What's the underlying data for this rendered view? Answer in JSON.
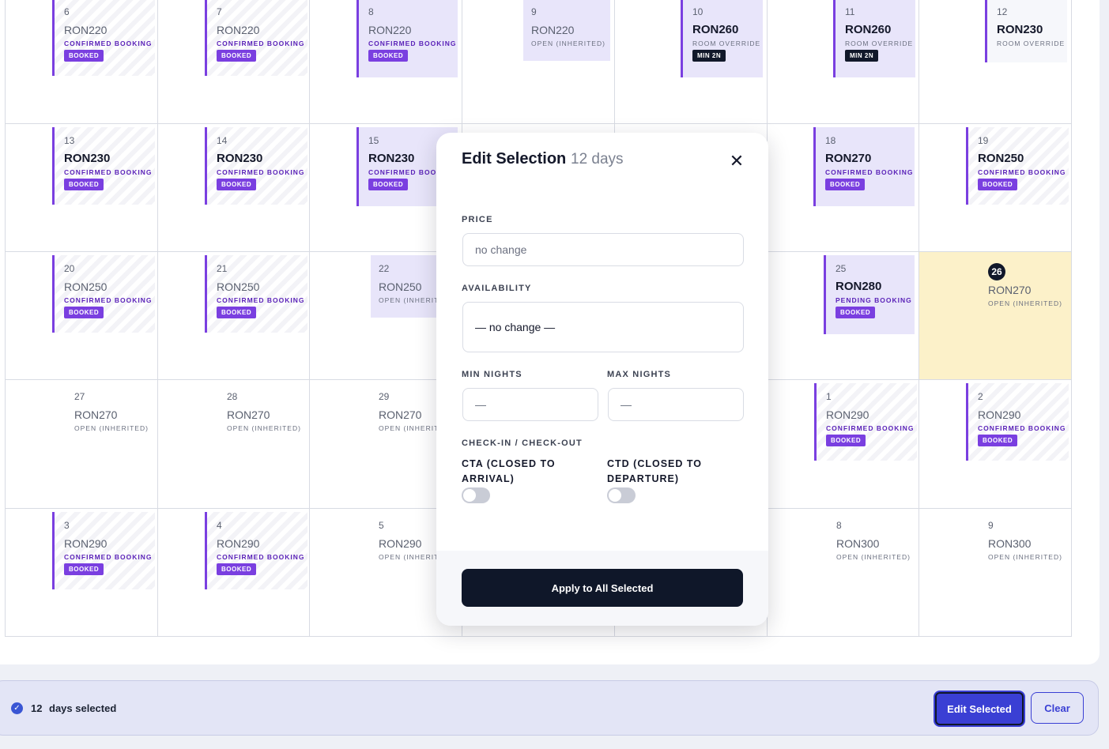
{
  "calendar": {
    "weeks": [
      [
        {
          "day": "6",
          "price": "RON220",
          "status": "CONFIRMED BOOKING",
          "badge": "BOOKED",
          "kind": "booked"
        },
        {
          "day": "7",
          "price": "RON220",
          "status": "CONFIRMED BOOKING",
          "badge": "BOOKED",
          "kind": "booked"
        },
        {
          "day": "8",
          "price": "RON220",
          "status": "CONFIRMED BOOKING",
          "badge": "BOOKED",
          "kind": "booked-hl"
        },
        {
          "day": "9",
          "price": "RON220",
          "status": "OPEN (INHERITED)",
          "kind": "open"
        },
        {
          "day": "10",
          "price": "RON260",
          "status": "ROOM OVERRIDE",
          "badge": "MIN 2N",
          "kind": "override"
        },
        {
          "day": "11",
          "price": "RON260",
          "status": "ROOM OVERRIDE",
          "badge": "MIN 2N",
          "kind": "override"
        },
        {
          "day": "12",
          "price": "RON230",
          "status": "ROOM OVERRIDE",
          "kind": "override-light"
        }
      ],
      [
        {
          "day": "13",
          "price": "RON230",
          "status": "CONFIRMED BOOKING",
          "badge": "BOOKED",
          "kind": "booked",
          "bold": true
        },
        {
          "day": "14",
          "price": "RON230",
          "status": "CONFIRMED BOOKING",
          "badge": "BOOKED",
          "kind": "booked",
          "bold": true
        },
        {
          "day": "15",
          "price": "RON230",
          "status": "CONFIRMED BOOKING",
          "badge": "BOOKED",
          "kind": "booked-hl",
          "bold": true
        },
        null,
        null,
        {
          "day": "18",
          "price": "RON270",
          "status": "CONFIRMED BOOKING",
          "badge": "BOOKED",
          "kind": "booked-hl",
          "bold": true
        },
        {
          "day": "19",
          "price": "RON250",
          "status": "CONFIRMED BOOKING",
          "badge": "BOOKED",
          "kind": "booked",
          "bold": true
        }
      ],
      [
        {
          "day": "20",
          "price": "RON250",
          "status": "CONFIRMED BOOKING",
          "badge": "BOOKED",
          "kind": "booked"
        },
        {
          "day": "21",
          "price": "RON250",
          "status": "CONFIRMED BOOKING",
          "badge": "BOOKED",
          "kind": "booked"
        },
        {
          "day": "22",
          "price": "RON250",
          "status": "OPEN (INHERITED)",
          "kind": "open"
        },
        null,
        null,
        {
          "day": "25",
          "price": "RON280",
          "status": "PENDING BOOKING",
          "badge": "BOOKED",
          "kind": "booked-hl",
          "bold": true
        },
        {
          "day": "26",
          "price": "RON270",
          "status": "OPEN (INHERITED)",
          "kind": "today"
        }
      ],
      [
        {
          "day": "27",
          "price": "RON270",
          "status": "OPEN (INHERITED)",
          "kind": "plain"
        },
        {
          "day": "28",
          "price": "RON270",
          "status": "OPEN (INHERITED)",
          "kind": "plain"
        },
        {
          "day": "29",
          "price": "RON270",
          "status": "OPEN (INHERITED)",
          "kind": "plain"
        },
        null,
        null,
        {
          "day": "1",
          "price": "RON290",
          "status": "CONFIRMED BOOKING",
          "badge": "BOOKED",
          "kind": "booked"
        },
        {
          "day": "2",
          "price": "RON290",
          "status": "CONFIRMED BOOKING",
          "badge": "BOOKED",
          "kind": "booked"
        }
      ],
      [
        {
          "day": "3",
          "price": "RON290",
          "status": "CONFIRMED BOOKING",
          "badge": "BOOKED",
          "kind": "booked"
        },
        {
          "day": "4",
          "price": "RON290",
          "status": "CONFIRMED BOOKING",
          "badge": "BOOKED",
          "kind": "booked"
        },
        {
          "day": "5",
          "price": "RON290",
          "status": "OPEN (INHERITED)",
          "kind": "plain"
        },
        null,
        null,
        {
          "day": "8",
          "price": "RON300",
          "status": "OPEN (INHERITED)",
          "kind": "plain"
        },
        {
          "day": "9",
          "price": "RON300",
          "status": "OPEN (INHERITED)",
          "kind": "plain"
        }
      ]
    ]
  },
  "modal": {
    "title": "Edit Selection",
    "subtitle": "12 days",
    "close_icon": "close-icon",
    "price_label": "PRICE",
    "price_placeholder": "no change",
    "availability_label": "AVAILABILITY",
    "availability_value": "— no change —",
    "min_nights_label": "MIN NIGHTS",
    "min_nights_placeholder": "—",
    "max_nights_label": "MAX NIGHTS",
    "max_nights_placeholder": "—",
    "checkin_label": "CHECK-IN / CHECK-OUT",
    "cta_label": "CTA (CLOSED TO ARRIVAL)",
    "ctd_label": "CTD (CLOSED TO DEPARTURE)",
    "cta_on": false,
    "ctd_on": false,
    "apply_label": "Apply to All Selected"
  },
  "selection_bar": {
    "icon": "check-circle-icon",
    "count": "12",
    "text": "days selected",
    "edit_label": "Edit Selected",
    "clear_label": "Clear"
  },
  "colors": {
    "accent": "#7a3fe0",
    "primary": "#3a3fd4",
    "dark": "#0f1729",
    "today": "#fcf1c9",
    "highlight": "#e8e5fa"
  }
}
